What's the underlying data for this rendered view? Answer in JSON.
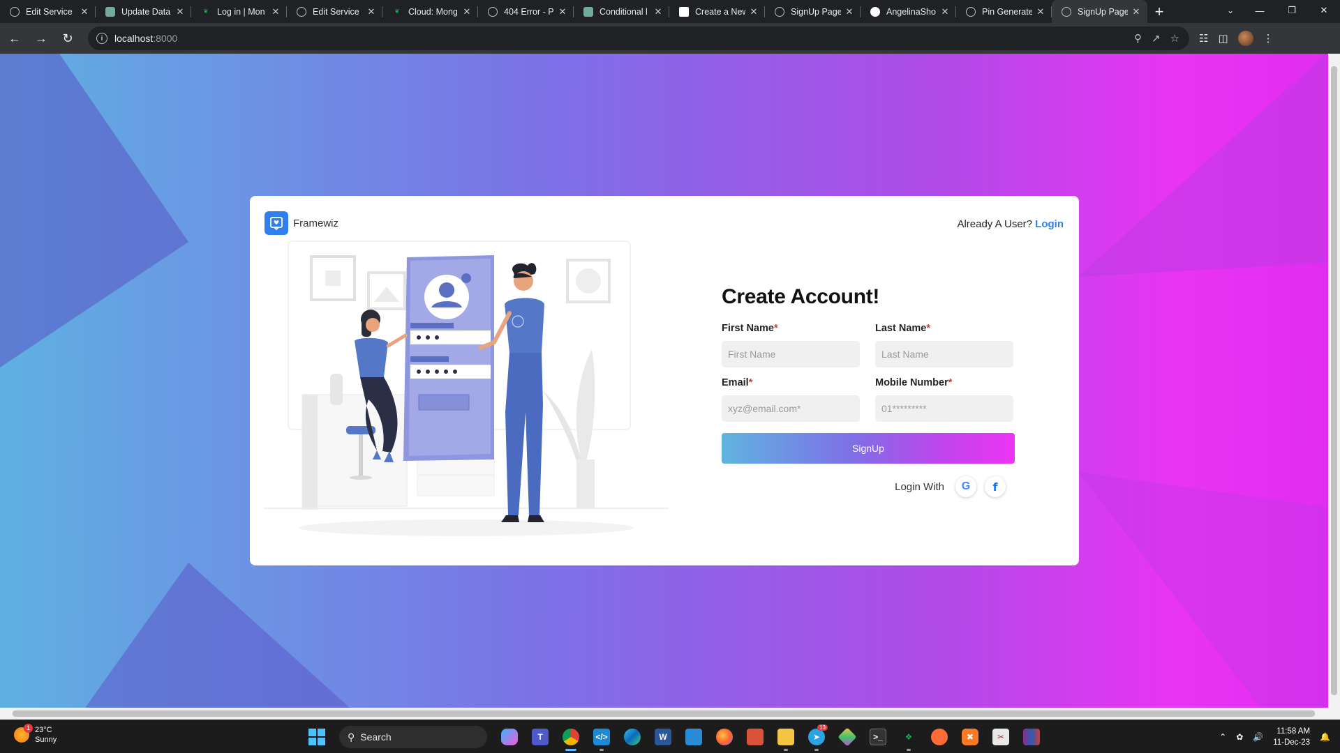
{
  "browser": {
    "tabs": [
      {
        "title": "Edit Service",
        "icon": "globe-icon"
      },
      {
        "title": "Update Data",
        "icon": "chatgpt-icon"
      },
      {
        "title": "Log in | Mon",
        "icon": "mongodb-leaf-icon"
      },
      {
        "title": "Edit Service",
        "icon": "globe-icon"
      },
      {
        "title": "Cloud: Mong",
        "icon": "mongodb-leaf-icon"
      },
      {
        "title": "404 Error - P",
        "icon": "globe-icon"
      },
      {
        "title": "Conditional l",
        "icon": "chatgpt-icon"
      },
      {
        "title": "Create a New",
        "icon": "codepen-icon"
      },
      {
        "title": "SignUp Page",
        "icon": "globe-icon"
      },
      {
        "title": "AngelinaSho",
        "icon": "github-icon"
      },
      {
        "title": "Pin Generate",
        "icon": "globe-icon"
      },
      {
        "title": "SignUp Page",
        "icon": "globe-icon",
        "active": true
      }
    ],
    "url_host": "localhost",
    "url_port": ":8000"
  },
  "page": {
    "brand_name": "Framewiz",
    "already_user_text": "Already A User?",
    "login_link": "Login",
    "heading": "Create Account!",
    "first_name_label": "First Name",
    "last_name_label": "Last Name",
    "email_label": "Email",
    "mobile_label": "Mobile Number",
    "required_mark": "*",
    "first_name_placeholder": "First Name",
    "last_name_placeholder": "Last Name",
    "email_placeholder": "xyz@email.com*",
    "mobile_placeholder": "01*********",
    "signup_button": "SignUp",
    "login_with_label": "Login With",
    "google_glyph": "G",
    "facebook_glyph": "f"
  },
  "taskbar": {
    "weather_temp": "23°C",
    "weather_desc": "Sunny",
    "weather_badge": "1",
    "search_label": "Search",
    "telegram_badge": "13",
    "time": "11:58 AM",
    "date": "11-Dec-23"
  },
  "colors": {
    "accent": "#2f80ed",
    "gradient_start": "#5fb4e0",
    "gradient_end": "#ec35f3",
    "required": "#e03131"
  }
}
